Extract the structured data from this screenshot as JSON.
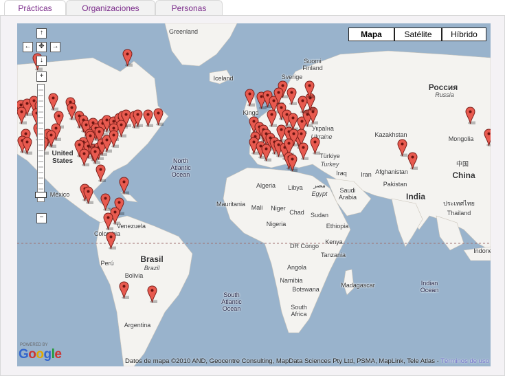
{
  "tabs": [
    {
      "label": "Prácticas"
    },
    {
      "label": "Organizaciones"
    },
    {
      "label": "Personas"
    }
  ],
  "map": {
    "map_types": {
      "map": "Mapa",
      "satellite": "Satélite",
      "hybrid": "Híbrido"
    },
    "attribution": "Datos de mapa ©2010 AND, Geocentre Consulting, MapData Sciences Pty Ltd, PSMA, MapLink, Tele Atlas -",
    "terms_link": "Términos de uso",
    "powered_by": "POWERED BY",
    "logo_text": "Google",
    "labels": {
      "greenland": "Greenland",
      "iceland": "Iceland",
      "sverige": "Sverige",
      "finland": "Suomi\nFinland",
      "kingdom": "Kingd",
      "russia": "Россия",
      "russia_sub": "Russia",
      "kazakhstan": "Kazakhstan",
      "mongolia": "Mongolia",
      "china_han": "中国",
      "china": "China",
      "afghanistan": "Afghanistan",
      "iran": "Iran",
      "iraq": "Iraq",
      "pakistan": "Pakistan",
      "india": "India",
      "thailand_thai": "ประเทศไทย",
      "thailand": "Thailand",
      "indonesia": "Indone",
      "ukraine": "Україна",
      "ukraine_sub": "Ukraine",
      "turkey": "Türkiye",
      "turkey_sub": "Turkey",
      "saudi": "Saudi\nArabia",
      "egypt": "مصر",
      "egypt_sub": "Egypt",
      "algeria": "Algeria",
      "libya": "Libya",
      "mauritania": "Mauritania",
      "mali": "Mali",
      "niger": "Niger",
      "chad": "Chad",
      "sudan": "Sudan",
      "ethiopia": "Ethiopia",
      "nigeria": "Nigeria",
      "drc": "DR Congo",
      "kenya": "Kenya",
      "tanzania": "Tanzania",
      "angola": "Angola",
      "namibia": "Namibia",
      "botswana": "Botswana",
      "madagascar": "Madagascar",
      "south_africa": "South\nAfrica",
      "mexico": "México",
      "united_states": "United\nStates",
      "venezuela": "Venezuela",
      "colombia": "Colombia",
      "peru": "Perú",
      "brasil": "Brasil",
      "brazil_sub": "Brazil",
      "bolivia": "Bolivia",
      "argentina": "Argentina",
      "north_atlantic": "North\nAtlantic\nOcean",
      "south_atlantic": "South\nAtlantic\nOcean",
      "indian_ocean": "Indian\nOcean"
    }
  },
  "colors": {
    "ocean": "#99b3cc",
    "land": "#f4f3f0",
    "pin": "#e85a4f",
    "tab_text": "#7a2a8a"
  },
  "icons": {
    "pan_up": "arrow-up-icon",
    "pan_down": "arrow-down-icon",
    "pan_left": "arrow-left-icon",
    "pan_right": "arrow-right-icon",
    "pan_center": "center-icon",
    "zoom_in": "plus-icon",
    "zoom_out": "minus-icon",
    "marker": "map-pin-icon"
  }
}
